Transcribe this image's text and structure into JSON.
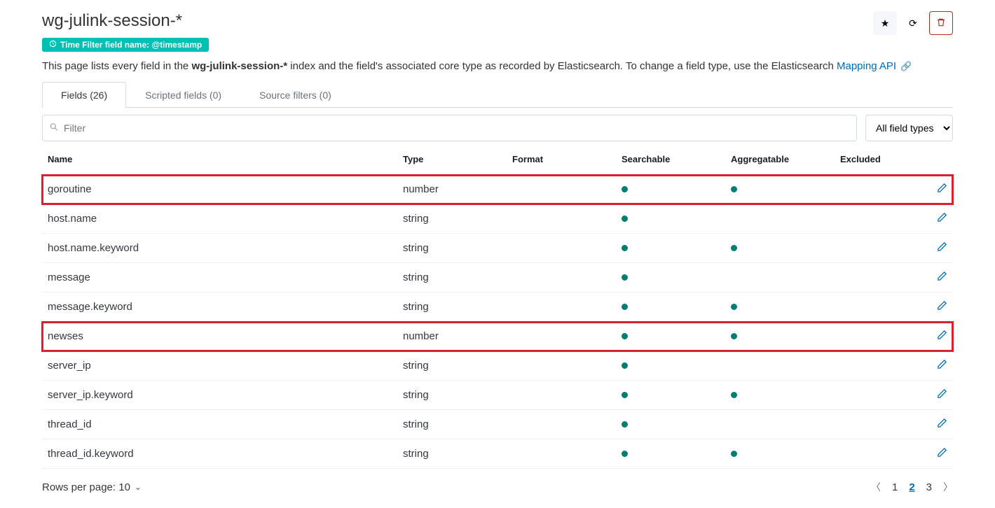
{
  "header": {
    "title": "wg-julink-session-*",
    "badge_prefix": "Time Filter field name: ",
    "badge_value": "@timestamp",
    "desc_before": "This page lists every field in the ",
    "desc_bold": "wg-julink-session-*",
    "desc_after": " index and the field's associated core type as recorded by Elasticsearch. To change a field type, use the Elasticsearch ",
    "desc_link": "Mapping API"
  },
  "tabs": [
    {
      "label": "Fields (26)",
      "active": true
    },
    {
      "label": "Scripted fields (0)",
      "active": false
    },
    {
      "label": "Source filters (0)",
      "active": false
    }
  ],
  "search": {
    "placeholder": "Filter"
  },
  "type_select": {
    "label": "All field types"
  },
  "columns": {
    "name": "Name",
    "type": "Type",
    "format": "Format",
    "searchable": "Searchable",
    "aggregatable": "Aggregatable",
    "excluded": "Excluded"
  },
  "rows": [
    {
      "name": "goroutine",
      "type": "number",
      "searchable": true,
      "aggregatable": true,
      "highlight": true
    },
    {
      "name": "host.name",
      "type": "string",
      "searchable": true,
      "aggregatable": false,
      "highlight": false
    },
    {
      "name": "host.name.keyword",
      "type": "string",
      "searchable": true,
      "aggregatable": true,
      "highlight": false
    },
    {
      "name": "message",
      "type": "string",
      "searchable": true,
      "aggregatable": false,
      "highlight": false
    },
    {
      "name": "message.keyword",
      "type": "string",
      "searchable": true,
      "aggregatable": true,
      "highlight": false
    },
    {
      "name": "newses",
      "type": "number",
      "searchable": true,
      "aggregatable": true,
      "highlight": true
    },
    {
      "name": "server_ip",
      "type": "string",
      "searchable": true,
      "aggregatable": false,
      "highlight": false
    },
    {
      "name": "server_ip.keyword",
      "type": "string",
      "searchable": true,
      "aggregatable": true,
      "highlight": false
    },
    {
      "name": "thread_id",
      "type": "string",
      "searchable": true,
      "aggregatable": false,
      "highlight": false
    },
    {
      "name": "thread_id.keyword",
      "type": "string",
      "searchable": true,
      "aggregatable": true,
      "highlight": false
    }
  ],
  "footer": {
    "rows_per_page_label": "Rows per page: 10",
    "pages": [
      "1",
      "2",
      "3"
    ],
    "active_page": "2"
  }
}
